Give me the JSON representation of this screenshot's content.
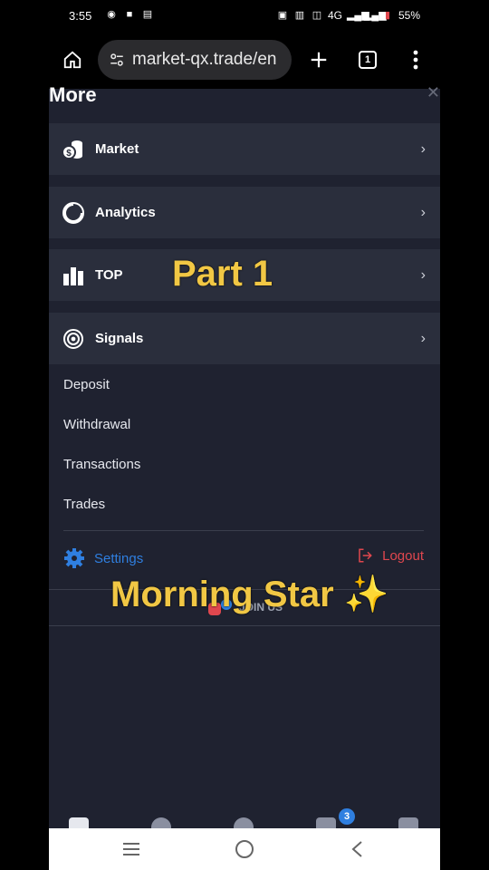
{
  "status": {
    "time": "3:55",
    "network": "4G",
    "battery": "55%"
  },
  "browser": {
    "url": "market-qx.trade/en",
    "tab_count": "1"
  },
  "panel": {
    "title": "More",
    "menu_items": [
      {
        "label": "Market",
        "icon": "coins-icon"
      },
      {
        "label": "Analytics",
        "icon": "pie-chart-icon"
      },
      {
        "label": "TOP",
        "icon": "bars-icon"
      },
      {
        "label": "Signals",
        "icon": "radar-icon"
      }
    ],
    "links": [
      "Deposit",
      "Withdrawal",
      "Transactions",
      "Trades"
    ],
    "settings_label": "Settings",
    "logout_label": "Logout",
    "join_label": "JOIN US"
  },
  "overlay": {
    "part": "Part 1",
    "caption": "Morning Star ✨"
  },
  "bottom_tabs": {
    "notification_count": "3"
  },
  "colors": {
    "panel_bg": "#1f2230",
    "row_bg": "#2a2e3c",
    "accent_blue": "#2f7fe0",
    "logout_red": "#e0474e",
    "overlay_yellow": "#f1c744"
  }
}
